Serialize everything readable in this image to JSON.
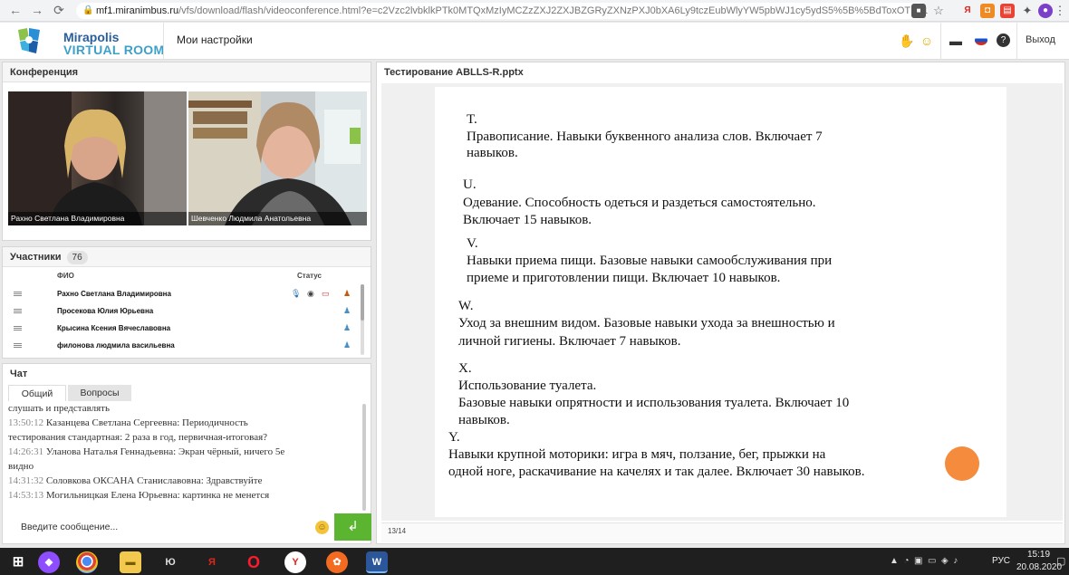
{
  "browser": {
    "url_host": "mf1.miranimbus.ru",
    "url_path": "/vfs/download/flash/videoconference.html?e=c2Vzc2lvbklkPTk0MTQxMzIyMCZzZXJ2ZXJBZGRyZXNzPXJ0bXA6Ly9tczEubWlyYW5pbWJ1cy5ydS5%5B%5BdToxOTM1L3Zpc..."
  },
  "app": {
    "brand_line1": "Mirapolis",
    "brand_line2": "VIRTUAL ROOM",
    "my_settings": "Мои настройки",
    "exit": "Выход"
  },
  "conference": {
    "title": "Конференция",
    "videos": [
      {
        "name": "Рахно Светлана Владимировна"
      },
      {
        "name": "Шевченко  Людмила  Анатольевна"
      }
    ]
  },
  "participants": {
    "title": "Участники",
    "count": "76",
    "col_name": "ФИО",
    "col_status": "Статус",
    "rows": [
      {
        "name": "Рахно Светлана Владимировна"
      },
      {
        "name": "Просекова  Юлия  Юрьевна"
      },
      {
        "name": "Крысина Ксения  Вячеславовна"
      },
      {
        "name": "филонова людмила  васильевна"
      }
    ]
  },
  "chat": {
    "title": "Чат",
    "tab_common": "Общий",
    "tab_questions": "Вопросы",
    "lines": [
      {
        "time": "",
        "text": "слушать и представлять"
      },
      {
        "time": "13:50:12",
        "text": " Казанцева Светлана  Сергеевна: Периодичность"
      },
      {
        "time": "",
        "text": "тестирования стандартная: 2 раза в год, первичная-итоговая?"
      },
      {
        "time": "14:26:31",
        "text": " Уланова  Наталья Геннадьевна: Экран чёрный, ничего 5е"
      },
      {
        "time": "",
        "text": "видно"
      },
      {
        "time": "14:31:32",
        "text": " Соловкова  ОКСАНА Станиславовна: Здравствуйте"
      },
      {
        "time": "14:53:13",
        "text": " Могильницкая  Елена Юрьевна: картинка не менется"
      }
    ],
    "input_placeholder": "Введите сообщение...",
    "send_icon": "enter-arrow-icon"
  },
  "presentation": {
    "title": "Тестирование ABLLS-R.pptx",
    "page": "13/14",
    "slide": {
      "T_letter": "T.",
      "T_1": "Правописание. Навыки буквенного анализа слов. Включает 7",
      "T_2": "навыков.",
      "U_letter": "U.",
      "U_1": "Одевание. Способность одеться и раздеться самостоятельно.",
      "U_2": "Включает 15 навыков.",
      "V_letter": "V.",
      "V_1": "Навыки приема пищи. Базовые навыки самообслуживания при",
      "V_2": "приеме и приготовлении пищи. Включает 10 навыков.",
      "W_letter": "W.",
      "W_1": "Уход за внешним видом. Базовые навыки ухода за внешностью и",
      "W_2": "личной гигиены. Включает 7 навыков.",
      "X_letter": "X.",
      "X_1": "Использование туалета.",
      "X_2": "Базовые навыки  опрятности и использования туалета. Включает 10",
      "X_3": "навыков.",
      "Y_letter": "Y.",
      "Y_1": "Навыки крупной моторики: игра в мяч, ползание, бег, прыжки на",
      "Y_2": "одной ноге, раскачивание на качелях и так далее. Включает 30 навыков."
    }
  },
  "taskbar": {
    "lang": "РУС",
    "time": "15:19",
    "date": "20.08.2020"
  },
  "colors": {
    "accent_green": "#5cb531",
    "slide_border": "#f4b7a0",
    "pointer": "#f58b3c"
  }
}
